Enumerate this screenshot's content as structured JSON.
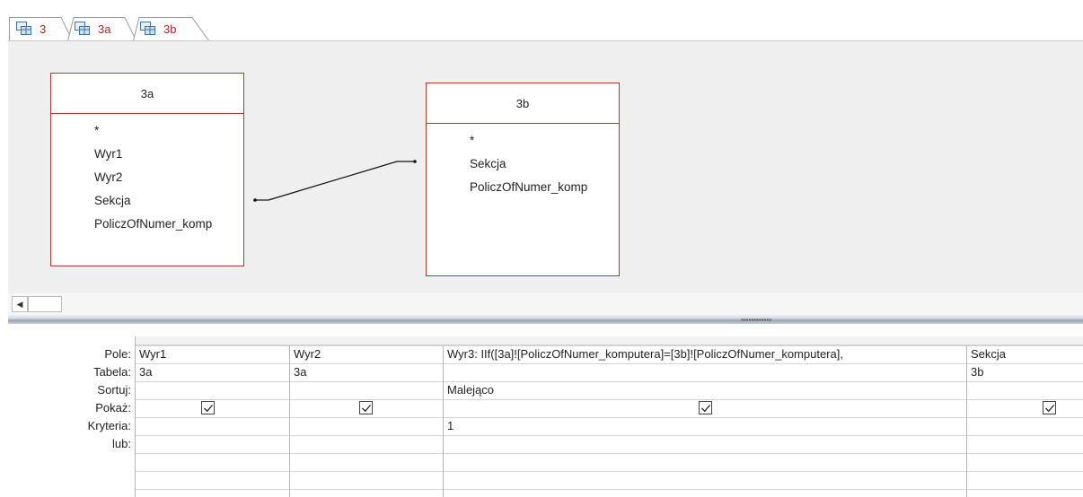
{
  "tabs": [
    {
      "label": "3",
      "icon": "query-icon",
      "active": true
    },
    {
      "label": "3a",
      "icon": "query-icon",
      "active": false
    },
    {
      "label": "3b",
      "icon": "query-icon",
      "active": false
    }
  ],
  "tables": [
    {
      "name": "3a",
      "fields": [
        "*",
        "Wyr1",
        "Wyr2",
        "Sekcja",
        "PoliczOfNumer_komp"
      ]
    },
    {
      "name": "3b",
      "fields": [
        "*",
        "Sekcja",
        "PoliczOfNumer_komp"
      ]
    }
  ],
  "row_labels": [
    "Pole:",
    "Tabela:",
    "Sortuj:",
    "Pokaż:",
    "Kryteria:",
    "lub:"
  ],
  "columns": [
    {
      "field": "Wyr1",
      "table": "3a",
      "sort": "",
      "show": true,
      "criteria": ""
    },
    {
      "field": "Wyr2",
      "table": "3a",
      "sort": "",
      "show": true,
      "criteria": ""
    },
    {
      "field": "Wyr3: IIf([3a]![PoliczOfNumer_komputera]=[3b]![PoliczOfNumer_komputera],",
      "table": "",
      "sort": "Malejąco",
      "show": true,
      "criteria": "1"
    },
    {
      "field": "Sekcja",
      "table": "3b",
      "sort": "",
      "show": true,
      "criteria": ""
    }
  ],
  "colors": {
    "accent": "#a4262c",
    "table_border": "#b5353a"
  }
}
